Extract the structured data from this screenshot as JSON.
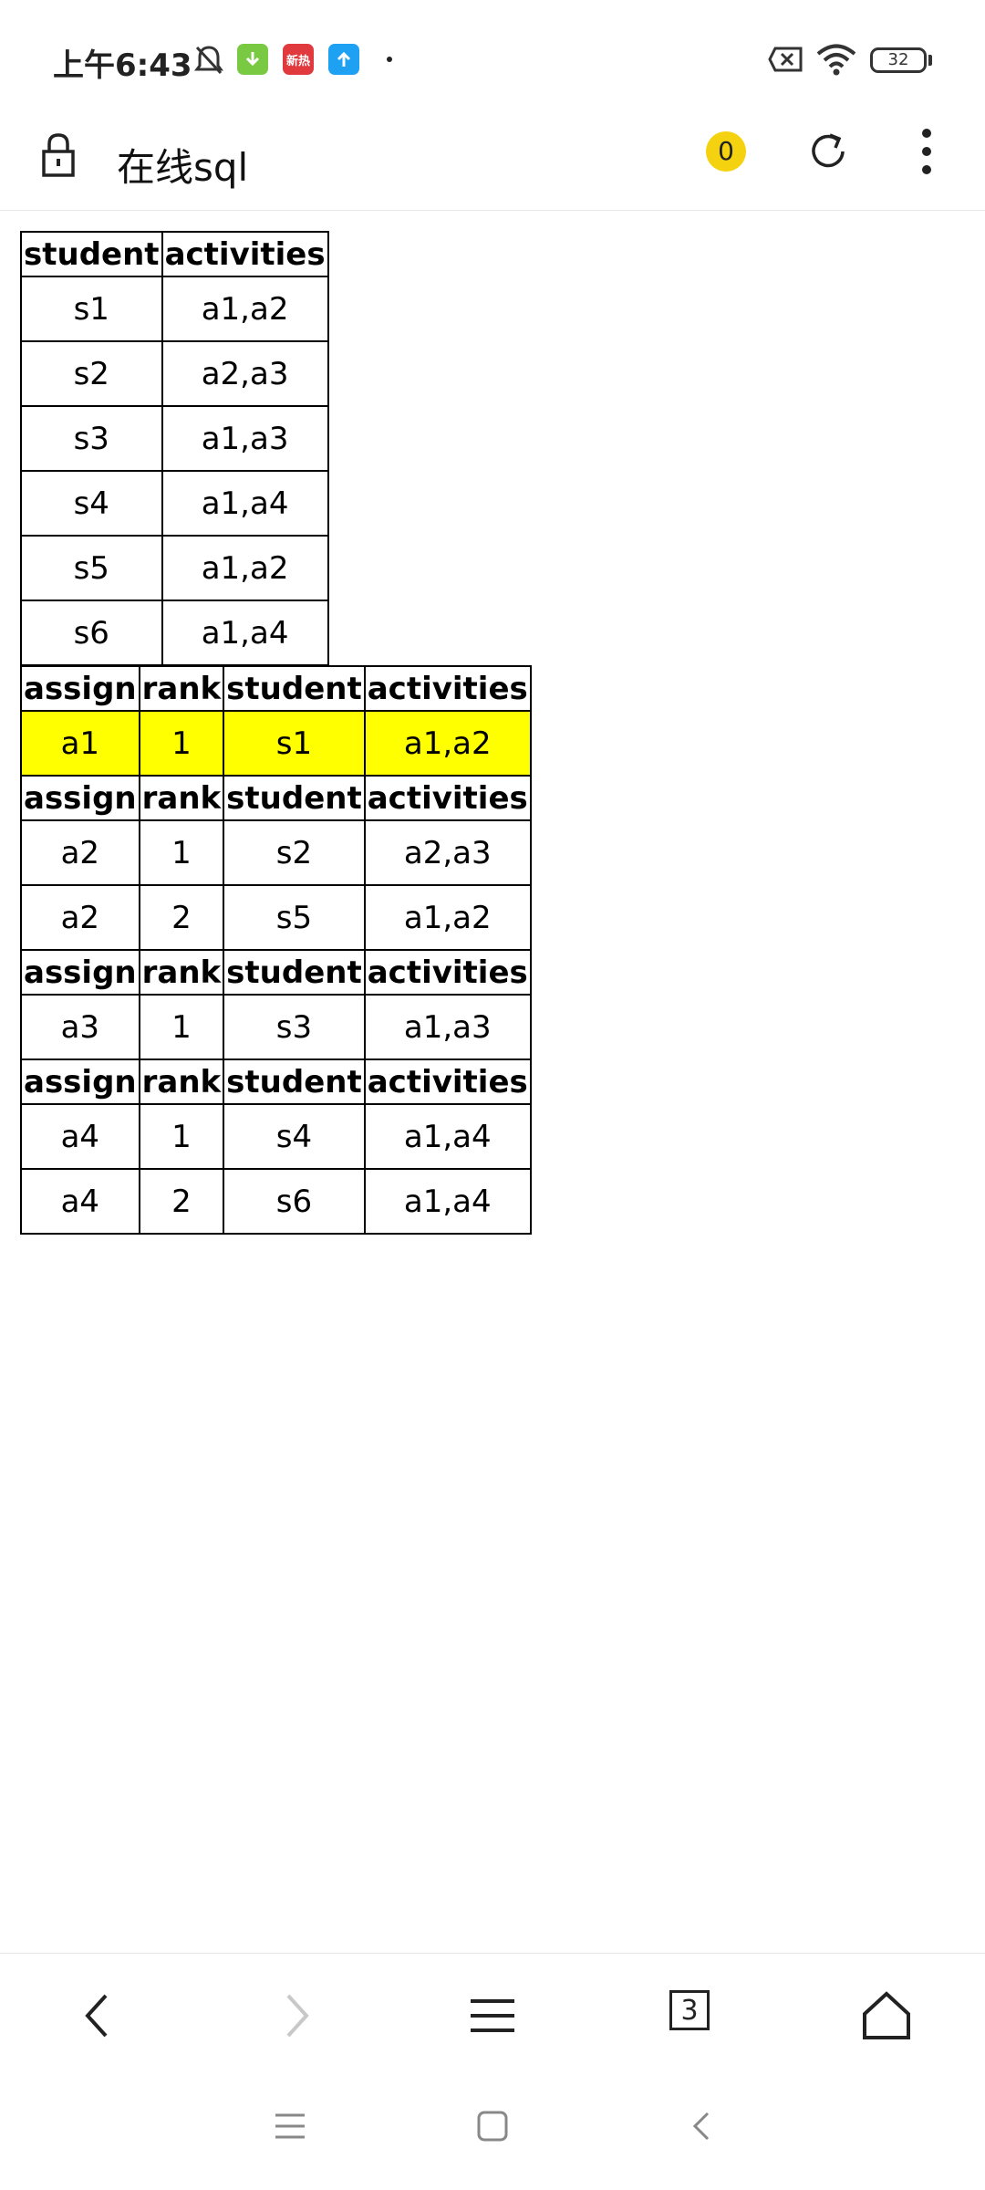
{
  "status_bar": {
    "time": "上午6:43",
    "battery": "32",
    "notifications": [
      {
        "icon": "download-app-icon",
        "color": "#7ac943"
      },
      {
        "icon": "news-app-icon",
        "color": "#e0393e",
        "label": "新热"
      },
      {
        "icon": "upload-app-icon",
        "color": "#1ea1f2"
      }
    ]
  },
  "header": {
    "title": "在线sql",
    "badge_count": "0"
  },
  "table1": {
    "headers": [
      "student",
      "activities"
    ],
    "rows": [
      [
        "s1",
        "a1,a2"
      ],
      [
        "s2",
        "a2,a3"
      ],
      [
        "s3",
        "a1,a3"
      ],
      [
        "s4",
        "a1,a4"
      ],
      [
        "s5",
        "a1,a2"
      ],
      [
        "s6",
        "a1,a4"
      ]
    ]
  },
  "table2": {
    "headers": [
      "assign",
      "rank",
      "student",
      "activities"
    ],
    "groups": [
      {
        "rows": [
          [
            "a1",
            "1",
            "s1",
            "a1,a2"
          ]
        ],
        "highlighted": true
      },
      {
        "rows": [
          [
            "a2",
            "1",
            "s2",
            "a2,a3"
          ],
          [
            "a2",
            "2",
            "s5",
            "a1,a2"
          ]
        ]
      },
      {
        "rows": [
          [
            "a3",
            "1",
            "s3",
            "a1,a3"
          ]
        ]
      },
      {
        "rows": [
          [
            "a4",
            "1",
            "s4",
            "a1,a4"
          ],
          [
            "a4",
            "2",
            "s6",
            "a1,a4"
          ]
        ]
      }
    ],
    "highlight_color": "#ffff00"
  },
  "toolbar": {
    "tabs_count": "3"
  }
}
